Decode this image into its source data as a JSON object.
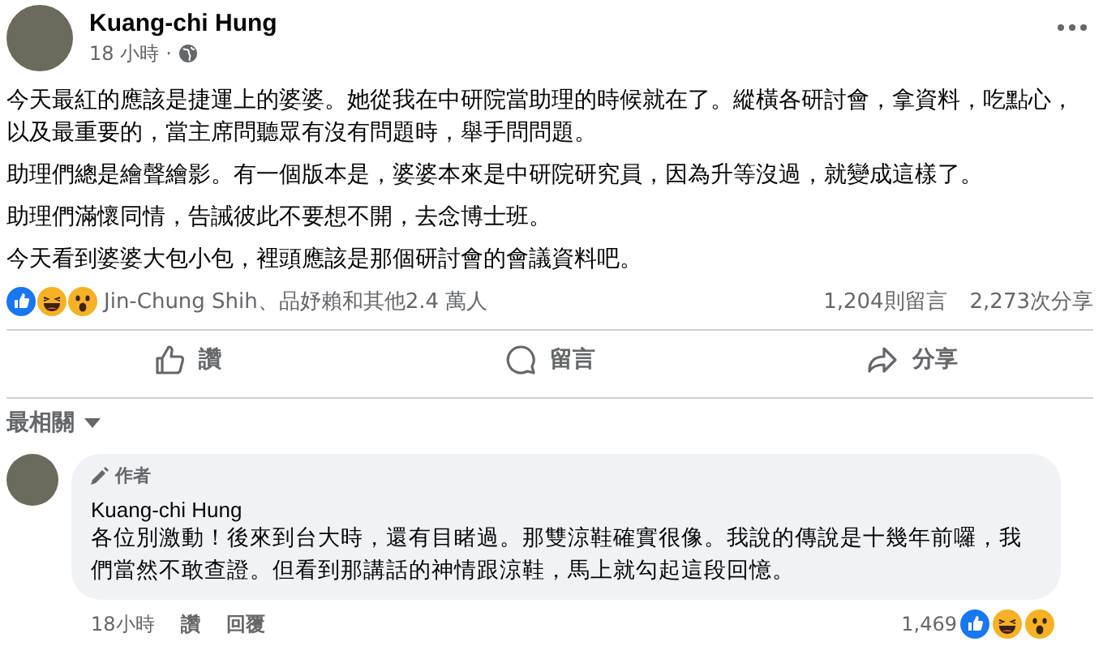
{
  "post": {
    "author": "Kuang-chi Hung",
    "time": "18 小時",
    "separator": "·",
    "paragraphs": [
      "今天最紅的應該是捷運上的婆婆。她從我在中研院當助理的時候就在了。縱橫各研討會，拿資料，吃點心，以及最重要的，當主席問聽眾有沒有問題時，舉手問問題。",
      "助理們總是繪聲繪影。有一個版本是，婆婆本來是中研院研究員，因為升等沒過，就變成這樣了。",
      "助理們滿懷同情，告誡彼此不要想不開，去念博士班。",
      "今天看到婆婆大包小包，裡頭應該是那個研討會的會議資料吧。"
    ],
    "reactions": {
      "names": "Jin-Chung Shih、品妤賴和其他2.4 萬人",
      "comments": "1,204則留言",
      "shares": "2,273次分享"
    },
    "actions": [
      {
        "kind": "like",
        "label": "讚"
      },
      {
        "kind": "comment",
        "label": "留言"
      },
      {
        "kind": "share",
        "label": "分享"
      }
    ]
  },
  "sort": {
    "label": "最相關"
  },
  "comment": {
    "badge": "作者",
    "author": "Kuang-chi Hung",
    "text": "各位別激動！後來到台大時，還有目睹過。那雙涼鞋確實很像。我說的傳說是十幾年前囉，我們當然不敢查證。但看到那講話的神情跟涼鞋，馬上就勾起這段回憶。",
    "time": "18小時",
    "like": "讚",
    "reply": "回覆",
    "count": "1,469"
  }
}
